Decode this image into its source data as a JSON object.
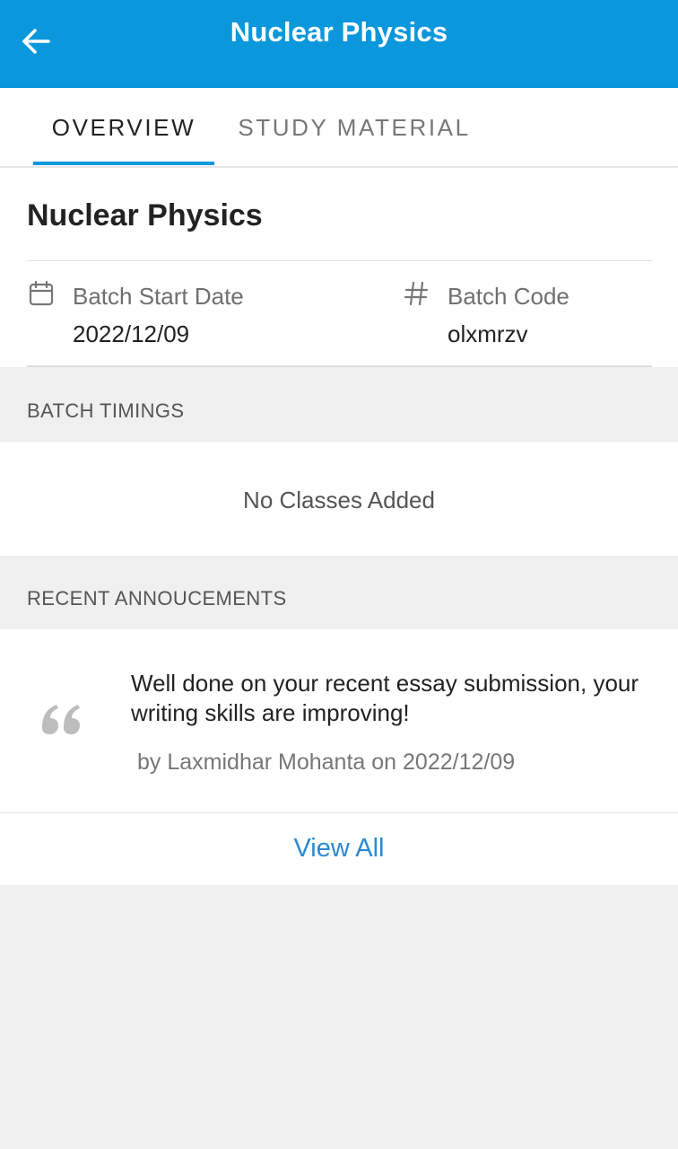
{
  "app_bar": {
    "title": "Nuclear Physics",
    "back_icon": "arrow-left-icon",
    "background": "#0a97dc"
  },
  "tabs": [
    {
      "label": "OVERVIEW",
      "active": true
    },
    {
      "label": "STUDY MATERIAL",
      "active": false
    }
  ],
  "course": {
    "title": "Nuclear Physics",
    "start_date": {
      "icon": "calendar-icon",
      "label": "Batch Start Date",
      "value": "2022/12/09"
    },
    "batch_code": {
      "icon": "hash-icon",
      "label": "Batch Code",
      "value": "olxmrzv"
    }
  },
  "batch_timings": {
    "header": "BATCH TIMINGS",
    "empty_text": "No Classes Added"
  },
  "announcements": {
    "header": "RECENT ANNOUCEMENTS",
    "items": [
      {
        "icon": "quote-icon",
        "text": "Well done on your recent essay submission, your writing skills are improving!",
        "meta": "by Laxmidhar Mohanta on 2022/12/09"
      }
    ],
    "view_all_label": "View All",
    "link_color": "#2a8ad1"
  }
}
